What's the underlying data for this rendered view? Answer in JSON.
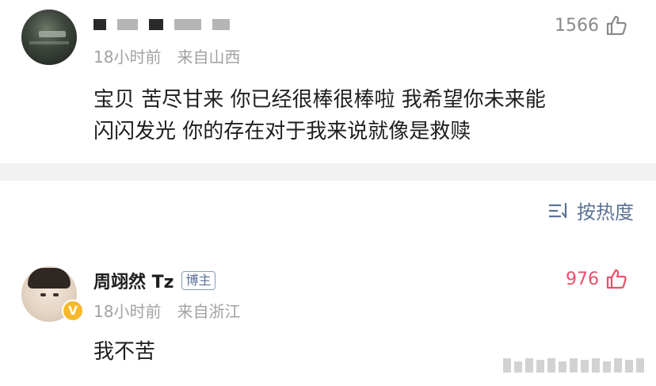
{
  "comments": [
    {
      "time": "18小时前",
      "location": "来自山西",
      "likes": "1566",
      "text_lines": [
        "宝贝 苦尽甘来 你已经很棒很棒啦 我希望你未来能",
        "闪闪发光 你的存在对于我来说就像是救赎"
      ]
    },
    {
      "username": "周翊然 Tz",
      "tag": "博主",
      "verified_mark": "V",
      "time": "18小时前",
      "location": "来自浙江",
      "likes": "976",
      "text": "我不苦"
    }
  ],
  "sort": {
    "label": "按热度",
    "icon": "sort-icon"
  },
  "colors": {
    "meta_gray": "#a2a2a2",
    "like_active": "#e8506a",
    "like_inactive": "#8a8a8a",
    "link_blue": "#5c7396",
    "verified_gold": "#f7b82c"
  }
}
